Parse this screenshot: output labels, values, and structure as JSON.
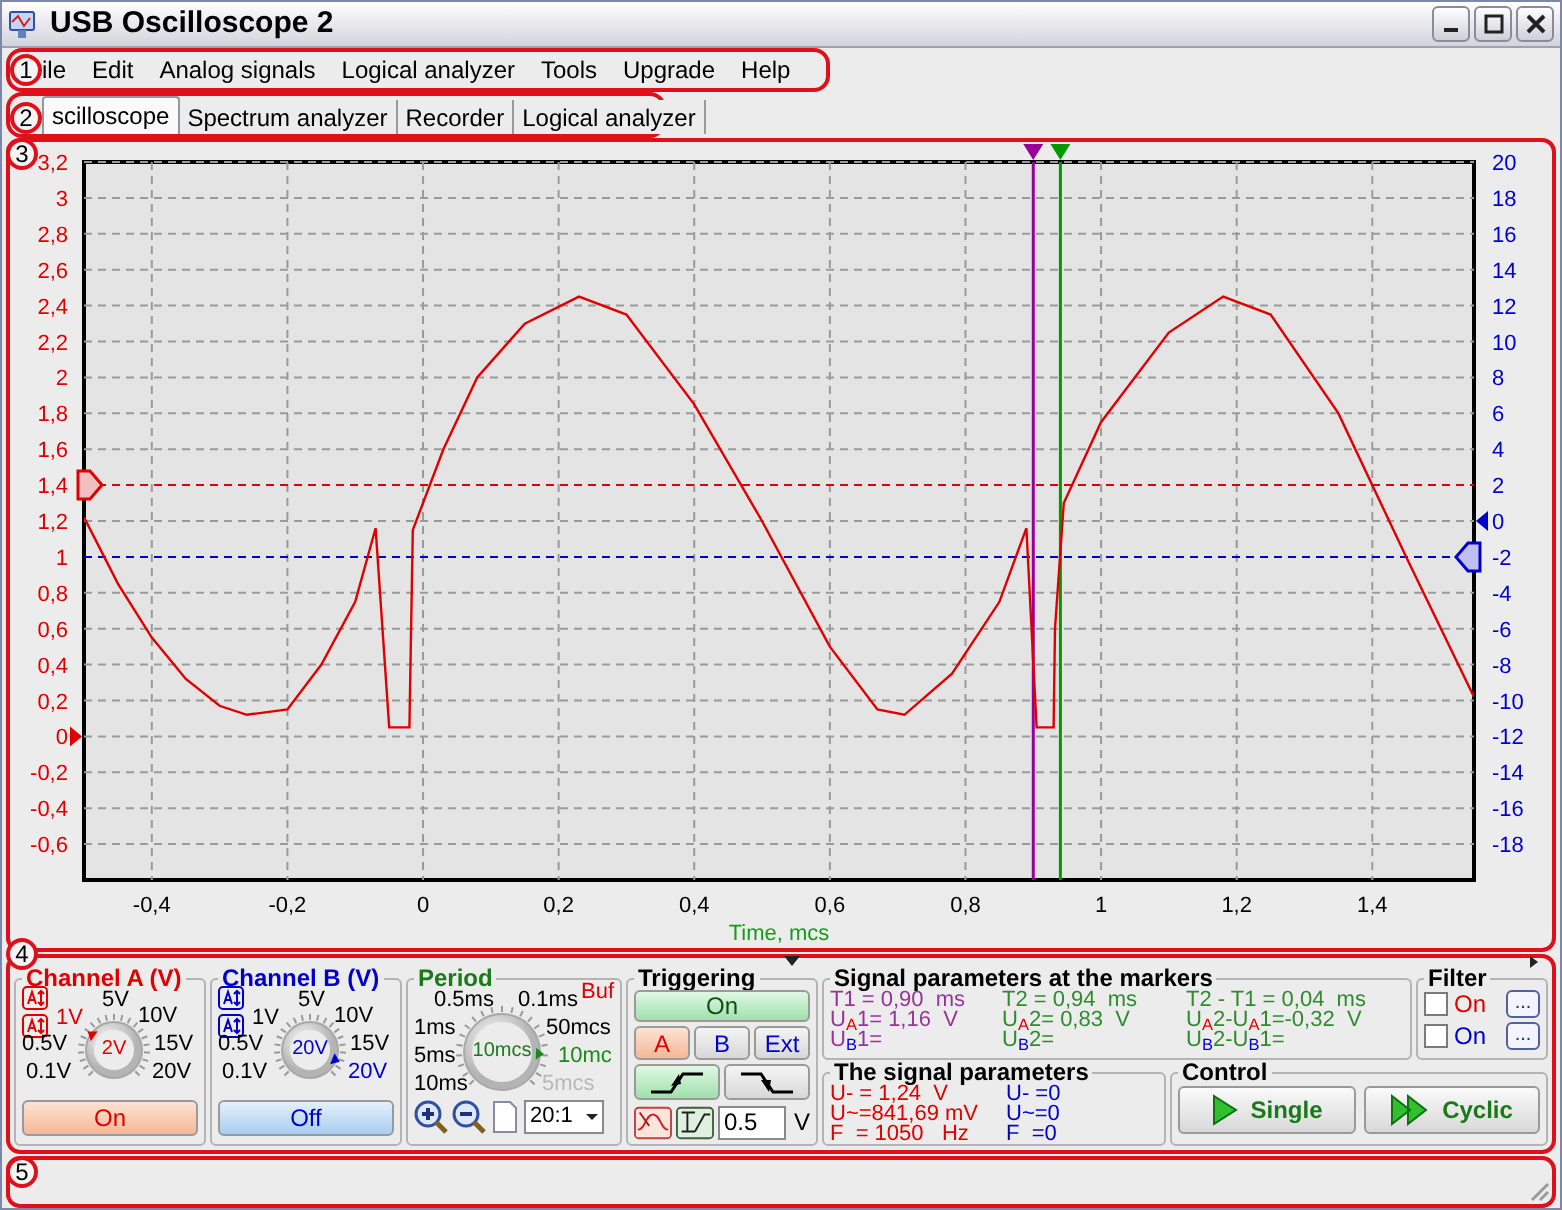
{
  "window": {
    "title": "USB Oscilloscope 2"
  },
  "menu": {
    "annotation": "1",
    "items": [
      "ile",
      "Edit",
      "Analog signals",
      "Logical analyzer",
      "Tools",
      "Upgrade",
      "Help"
    ]
  },
  "tabs": {
    "annotation": "2",
    "items": [
      {
        "label": "scilloscope",
        "selected": true
      },
      {
        "label": "Spectrum analyzer",
        "selected": false
      },
      {
        "label": "Recorder",
        "selected": false
      },
      {
        "label": "Logical analyzer",
        "selected": false
      }
    ]
  },
  "scope": {
    "annotation": "3",
    "chart_data": {
      "type": "line",
      "xlabel": "Time, mcs",
      "x": [
        -0.5,
        -0.45,
        -0.4,
        -0.35,
        -0.3,
        -0.26,
        -0.2,
        -0.15,
        -0.1,
        -0.07,
        -0.05,
        -0.02,
        -0.015,
        0.03,
        0.08,
        0.15,
        0.23,
        0.3,
        0.4,
        0.5,
        0.6,
        0.67,
        0.71,
        0.78,
        0.85,
        0.89,
        0.905,
        0.93,
        0.932,
        0.945,
        1.0,
        1.1,
        1.18,
        1.25,
        1.35,
        1.45,
        1.55
      ],
      "grid": true,
      "series": [
        {
          "color": "#e00000",
          "values": [
            1.22,
            0.85,
            0.55,
            0.32,
            0.17,
            0.12,
            0.15,
            0.4,
            0.75,
            1.16,
            0.05,
            0.05,
            1.15,
            1.6,
            2.0,
            2.3,
            2.45,
            2.35,
            1.85,
            1.2,
            0.5,
            0.15,
            0.12,
            0.35,
            0.75,
            1.16,
            0.05,
            0.05,
            0.6,
            1.3,
            1.75,
            2.25,
            2.45,
            2.35,
            1.8,
            1.0,
            0.22
          ]
        }
      ],
      "xlim": [
        -0.5,
        1.55
      ],
      "ylim": [
        -0.8,
        3.2
      ],
      "y2lim": [
        -20,
        20
      ],
      "xticks": [
        {
          "value": -0.4,
          "label": "-0,4"
        },
        {
          "value": -0.2,
          "label": "-0,2"
        },
        {
          "value": 0,
          "label": "0"
        },
        {
          "value": 0.2,
          "label": "0,2"
        },
        {
          "value": 0.4,
          "label": "0,4"
        },
        {
          "value": 0.6,
          "label": "0,6"
        },
        {
          "value": 0.8,
          "label": "0,8"
        },
        {
          "value": 1,
          "label": "1"
        },
        {
          "value": 1.2,
          "label": "1,2"
        },
        {
          "value": 1.4,
          "label": "1,4"
        }
      ],
      "yticks": [
        {
          "value": 3.2,
          "label": "3,2"
        },
        {
          "value": 3,
          "label": "3"
        },
        {
          "value": 2.8,
          "label": "2,8"
        },
        {
          "value": 2.6,
          "label": "2,6"
        },
        {
          "value": 2.4,
          "label": "2,4"
        },
        {
          "value": 2.2,
          "label": "2,2"
        },
        {
          "value": 2,
          "label": "2"
        },
        {
          "value": 1.8,
          "label": "1,8"
        },
        {
          "value": 1.6,
          "label": "1,6"
        },
        {
          "value": 1.4,
          "label": "1,4"
        },
        {
          "value": 1.2,
          "label": "1,2"
        },
        {
          "value": 1,
          "label": "1"
        },
        {
          "value": 0.8,
          "label": "0,8"
        },
        {
          "value": 0.6,
          "label": "0,6"
        },
        {
          "value": 0.4,
          "label": "0,4"
        },
        {
          "value": 0.2,
          "label": "0,2"
        },
        {
          "value": 0,
          "label": "0"
        },
        {
          "value": -0.2,
          "label": "-0,2"
        },
        {
          "value": -0.4,
          "label": "-0,4"
        },
        {
          "value": -0.6,
          "label": "-0,6"
        }
      ],
      "y2ticks": [
        20,
        18,
        16,
        14,
        12,
        10,
        8,
        6,
        4,
        2,
        0,
        -2,
        -4,
        -6,
        -8,
        -10,
        -12,
        -14,
        -16,
        -18
      ],
      "ref_lines": [
        {
          "axis": "x",
          "value": 0.9,
          "color": "#990099"
        },
        {
          "axis": "x",
          "value": 0.94,
          "color": "#009900"
        },
        {
          "axis": "y",
          "value": 1.4,
          "color": "#e00000"
        },
        {
          "axis": "y",
          "value": 1,
          "color": "#0000cc"
        }
      ]
    }
  },
  "controls": {
    "annotation": "4",
    "channels": [
      {
        "title": "Channel A (V)",
        "color": "#e00000",
        "knob": {
          "labels": [
            {
              "text": "5V",
              "selected": false
            },
            {
              "text": "10V",
              "selected": false
            },
            {
              "text": "15V",
              "selected": false
            },
            {
              "text": "20V",
              "selected": false
            },
            {
              "text": "0.1V",
              "selected": false
            },
            {
              "text": "0.5V",
              "selected": false
            },
            {
              "text": "1V",
              "selected": true
            }
          ],
          "value": "2V"
        },
        "button": {
          "label": "On",
          "on": true
        }
      },
      {
        "title": "Channel B (V)",
        "color": "#0000cc",
        "knob": {
          "labels": [
            {
              "text": "5V",
              "selected": false
            },
            {
              "text": "10V",
              "selected": false
            },
            {
              "text": "15V",
              "selected": false
            },
            {
              "text": "20V",
              "selected": true
            },
            {
              "text": "0.1V",
              "selected": false
            },
            {
              "text": "0.5V",
              "selected": false
            },
            {
              "text": "1V",
              "selected": false
            }
          ],
          "value": "20V"
        },
        "button": {
          "label": "Off",
          "on": false
        }
      }
    ],
    "period": {
      "title": "Period",
      "buffer": "Buf",
      "knob": {
        "labels": [
          {
            "text": "0.5ms",
            "disabled": false,
            "selected": false
          },
          {
            "text": "0.1ms",
            "disabled": false,
            "selected": false
          },
          {
            "text": "1ms",
            "disabled": false,
            "selected": false
          },
          {
            "text": "50mcs",
            "disabled": false,
            "selected": false
          },
          {
            "text": "5ms",
            "disabled": false,
            "selected": false
          },
          {
            "text": "10mc",
            "disabled": false,
            "selected": true
          },
          {
            "text": "10ms",
            "disabled": false,
            "selected": false
          },
          {
            "text": "5mcs",
            "disabled": true,
            "selected": false
          }
        ],
        "value": "10mcs"
      },
      "ratio": "20:1"
    },
    "triggering": {
      "title": "Triggering",
      "button": {
        "label": "On",
        "on": true
      },
      "sources": [
        {
          "label": "A",
          "selected": true
        },
        {
          "label": "B",
          "selected": false
        },
        {
          "label": "Ext",
          "selected": false
        }
      ],
      "edges": [
        {
          "kind": "rising",
          "selected": true
        },
        {
          "kind": "falling",
          "selected": false
        }
      ],
      "threshold": "0.5",
      "unit": "V"
    },
    "markers": {
      "title": "Signal parameters at the markers",
      "columns": [
        {
          "color": "#993399",
          "lines": [
            {
              "text": "T1 = 0,90  ms"
            },
            {
              "text": "U$_{A}$1= 1,16  V",
              "color": "#e00000"
            },
            {
              "text": "U$_{B}$1=",
              "color": "#0000cc"
            }
          ]
        },
        {
          "color": "#2e8b2e",
          "lines": [
            {
              "text": "T2 = 0,94  ms"
            },
            {
              "text": "U$_{A}$2= 0,83  V",
              "color": "#e00000"
            },
            {
              "text": "U$_{B}$2=",
              "color": "#0000cc"
            }
          ]
        },
        {
          "color": "#2e8b2e",
          "lines": [
            {
              "text": "T2 - T1 = 0,04  ms"
            },
            {
              "text": "U$_{A}$2-U$_{A}$1=-0,32  V",
              "color": "#e00000"
            },
            {
              "text": "U$_{B}$2-U$_{B}$1=",
              "color": "#0000cc"
            }
          ]
        }
      ]
    },
    "filter": {
      "title": "Filter",
      "items": [
        {
          "label": "On",
          "checked": false,
          "color": "#e00000",
          "button": "..."
        },
        {
          "label": "On",
          "checked": false,
          "color": "#0000cc",
          "button": "..."
        }
      ]
    },
    "signal": {
      "title": "The signal parameters",
      "columns": [
        {
          "color": "#e00000",
          "lines": [
            {
              "text": "U- = 1,24  V"
            },
            {
              "text": "U~=841,69 mV"
            },
            {
              "text": "F  = 1050   Hz"
            }
          ]
        },
        {
          "color": "#0000cc",
          "lines": [
            {
              "text": "U- =0"
            },
            {
              "text": "U~=0"
            },
            {
              "text": "F  =0"
            }
          ]
        }
      ]
    },
    "control": {
      "title": "Control",
      "buttons": [
        {
          "label": "Single",
          "kind": "single"
        },
        {
          "label": "Cyclic",
          "kind": "cyclic"
        }
      ]
    }
  },
  "status_bar": {
    "annotation": "5"
  }
}
